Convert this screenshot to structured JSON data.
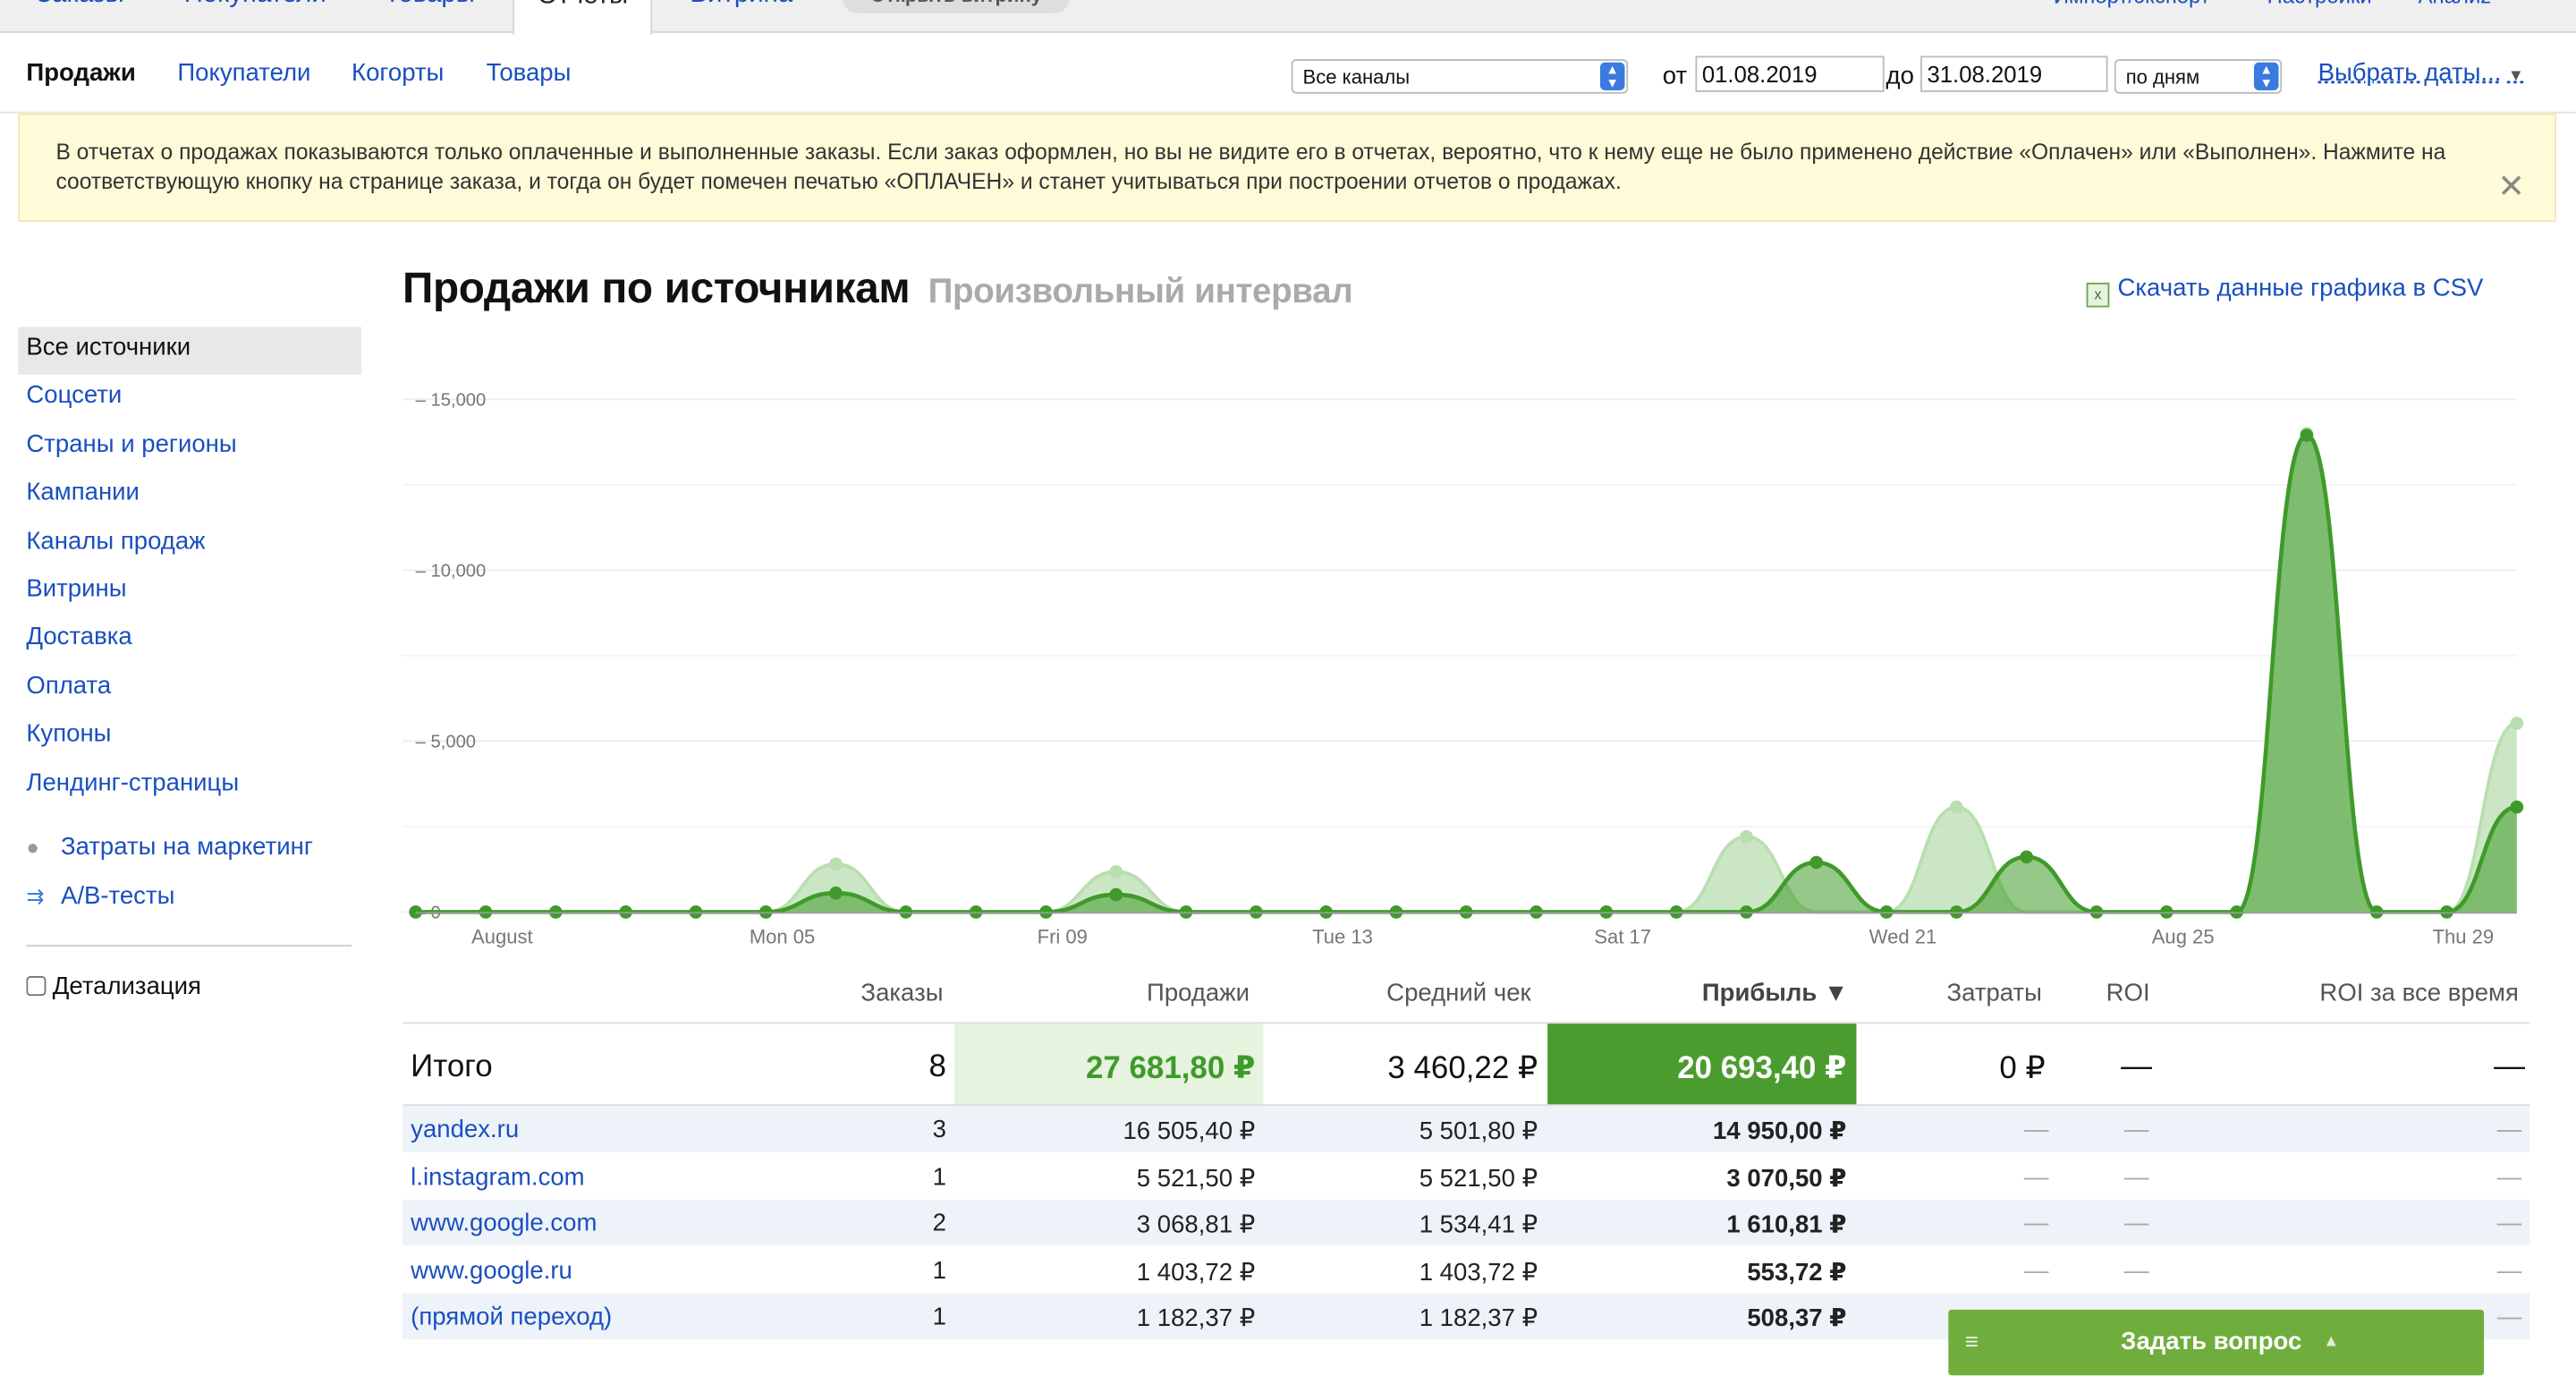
{
  "top_nav": {
    "tabs": [
      "Заказы",
      "Покупатели",
      "Товары",
      "Отчеты",
      "Витрина"
    ],
    "open_store": "Открыть витрину",
    "right_links": [
      "Импорт/экспорт",
      "Настройки",
      "Аналиz"
    ]
  },
  "sub_nav": {
    "tabs": [
      "Продажи",
      "Покупатели",
      "Когорты",
      "Товары"
    ],
    "channel_select": "Все каналы",
    "from_label": "от",
    "from_date": "01.08.2019",
    "to_label": "до",
    "to_date": "31.08.2019",
    "period_select": "по дням",
    "choose_dates": "Выбрать даты..."
  },
  "notice": {
    "text": "В отчетах о продажах показываются только оплаченные и выполненные заказы. Если заказ оформлен, но вы не видите его в отчетах, вероятно, что к нему еще не было применено действие «Оплачен» или «Выполнен». Нажмите на соответствующую кнопку на странице заказа, и тогда он будет помечен печатью «ОПЛАЧЕН» и станет учитываться при построении отчетов о продажах.",
    "close": "✕"
  },
  "sidebar": {
    "items": [
      "Все источники",
      "Соцсети",
      "Страны и регионы",
      "Кампании",
      "Каналы продаж",
      "Витрины",
      "Доставка",
      "Оплата",
      "Купоны",
      "Лендинг-страницы"
    ],
    "marketing": "Затраты на маркетинг",
    "ab_tests": "A/B-тесты",
    "detail": "Детализация"
  },
  "page": {
    "title": "Продажи по источникам",
    "subtitle": "Произвольный интервал",
    "csv_link": "Скачать данные графика в CSV"
  },
  "chart_data": {
    "type": "area",
    "x": [
      "2019-08-01",
      "2019-08-02",
      "2019-08-03",
      "2019-08-04",
      "2019-08-05",
      "2019-08-06",
      "2019-08-07",
      "2019-08-08",
      "2019-08-09",
      "2019-08-10",
      "2019-08-11",
      "2019-08-12",
      "2019-08-13",
      "2019-08-14",
      "2019-08-15",
      "2019-08-16",
      "2019-08-17",
      "2019-08-18",
      "2019-08-19",
      "2019-08-20",
      "2019-08-21",
      "2019-08-22",
      "2019-08-23",
      "2019-08-24",
      "2019-08-25",
      "2019-08-26",
      "2019-08-27",
      "2019-08-28",
      "2019-08-29",
      "2019-08-30",
      "2019-08-31"
    ],
    "x_tick_labels": [
      "August",
      "Mon 05",
      "Fri 09",
      "Tue 13",
      "Sat 17",
      "Wed 21",
      "Aug 25",
      "Thu 29"
    ],
    "y_ticks": [
      "0",
      "5,000",
      "10,000",
      "15,000"
    ],
    "ylim": [
      0,
      15000
    ],
    "series": [
      {
        "values": [
          0,
          0,
          0,
          0,
          0,
          0,
          1404,
          0,
          0,
          0,
          1182,
          0,
          0,
          0,
          0,
          0,
          0,
          0,
          0,
          2203,
          0,
          0,
          3069,
          0,
          0,
          0,
          0,
          14000,
          0,
          0,
          5522
        ],
        "color": "#b9deb0"
      },
      {
        "values": [
          0,
          0,
          0,
          0,
          0,
          0,
          554,
          0,
          0,
          0,
          508,
          0,
          0,
          0,
          0,
          0,
          0,
          0,
          0,
          0,
          1450,
          0,
          0,
          1611,
          0,
          0,
          0,
          13950,
          0,
          0,
          3071
        ],
        "color": "#3f9a2a"
      }
    ]
  },
  "table": {
    "headers": [
      "Заказы",
      "Продажи",
      "Средний чек",
      "Прибыль ▼",
      "Затраты",
      "ROI",
      "ROI за все время"
    ],
    "total": {
      "label": "Итого",
      "orders": "8",
      "sales": "27 681,80 ₽",
      "avg": "3 460,22 ₽",
      "profit": "20 693,40 ₽",
      "costs": "0 ₽",
      "roi": "—",
      "roi_all": "—"
    },
    "rows": [
      {
        "source": "yandex.ru",
        "orders": "3",
        "sales": "16 505,40 ₽",
        "avg": "5 501,80 ₽",
        "profit": "14 950,00 ₽",
        "costs": "—",
        "roi": "—",
        "roi_all": "—"
      },
      {
        "source": "l.instagram.com",
        "orders": "1",
        "sales": "5 521,50 ₽",
        "avg": "5 521,50 ₽",
        "profit": "3 070,50 ₽",
        "costs": "—",
        "roi": "—",
        "roi_all": "—"
      },
      {
        "source": "www.google.com",
        "orders": "2",
        "sales": "3 068,81 ₽",
        "avg": "1 534,41 ₽",
        "profit": "1 610,81 ₽",
        "costs": "—",
        "roi": "—",
        "roi_all": "—"
      },
      {
        "source": "www.google.ru",
        "orders": "1",
        "sales": "1 403,72 ₽",
        "avg": "1 403,72 ₽",
        "profit": "553,72 ₽",
        "costs": "—",
        "roi": "—",
        "roi_all": "—"
      },
      {
        "source": "(прямой переход)",
        "orders": "1",
        "sales": "1 182,37 ₽",
        "avg": "1 182,37 ₽",
        "profit": "508,37 ₽",
        "costs": "—",
        "roi": "—",
        "roi_all": "—"
      }
    ]
  },
  "help_button": {
    "menu_icon": "≡",
    "label": "Задать вопрос",
    "arrow": "▲"
  }
}
